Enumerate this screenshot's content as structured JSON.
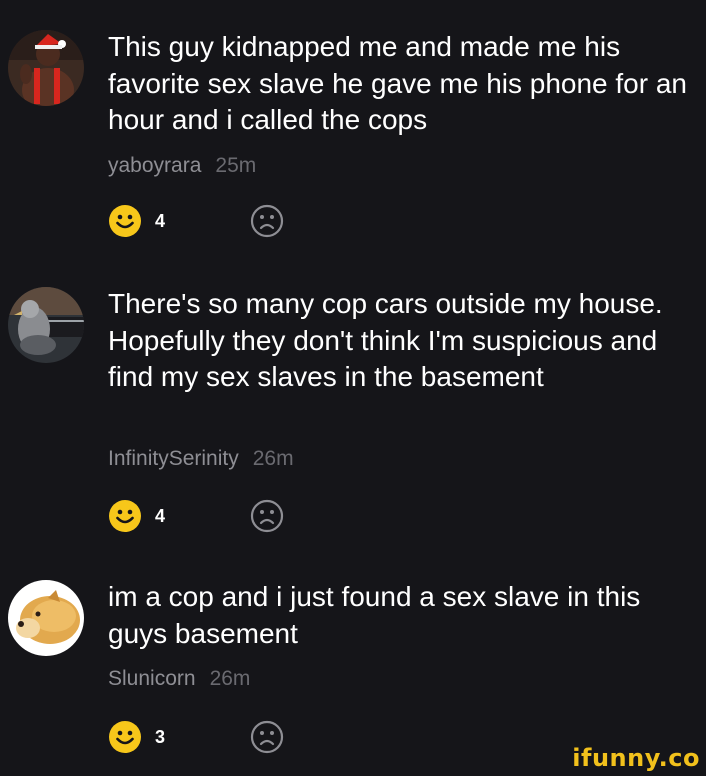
{
  "comments": [
    {
      "text": "This guy kidnapped me and made me his favorite sex slave he gave me his phone for an hour and i called the cops",
      "username": "yaboyrara",
      "time": "25m",
      "smile_count": "4"
    },
    {
      "text": "There's so many cop cars outside my house. Hopefully they don't think I'm suspicious and find my sex slaves in the basement",
      "username": "InfinitySerinity",
      "time": "26m",
      "smile_count": "4"
    },
    {
      "text": "im a cop and i just found a sex slave in this guys basement",
      "username": "Slunicorn",
      "time": "26m",
      "smile_count": "3"
    }
  ],
  "watermark": "ifunny.co",
  "colors": {
    "background": "#151519",
    "text": "#ffffff",
    "username": "#8e8e94",
    "timestamp": "#6a6a70",
    "smile_yellow": "#f7c71a",
    "frown_outline": "#8e8e94"
  },
  "icons": {
    "smile": "smile-icon",
    "frown": "frown-icon"
  }
}
